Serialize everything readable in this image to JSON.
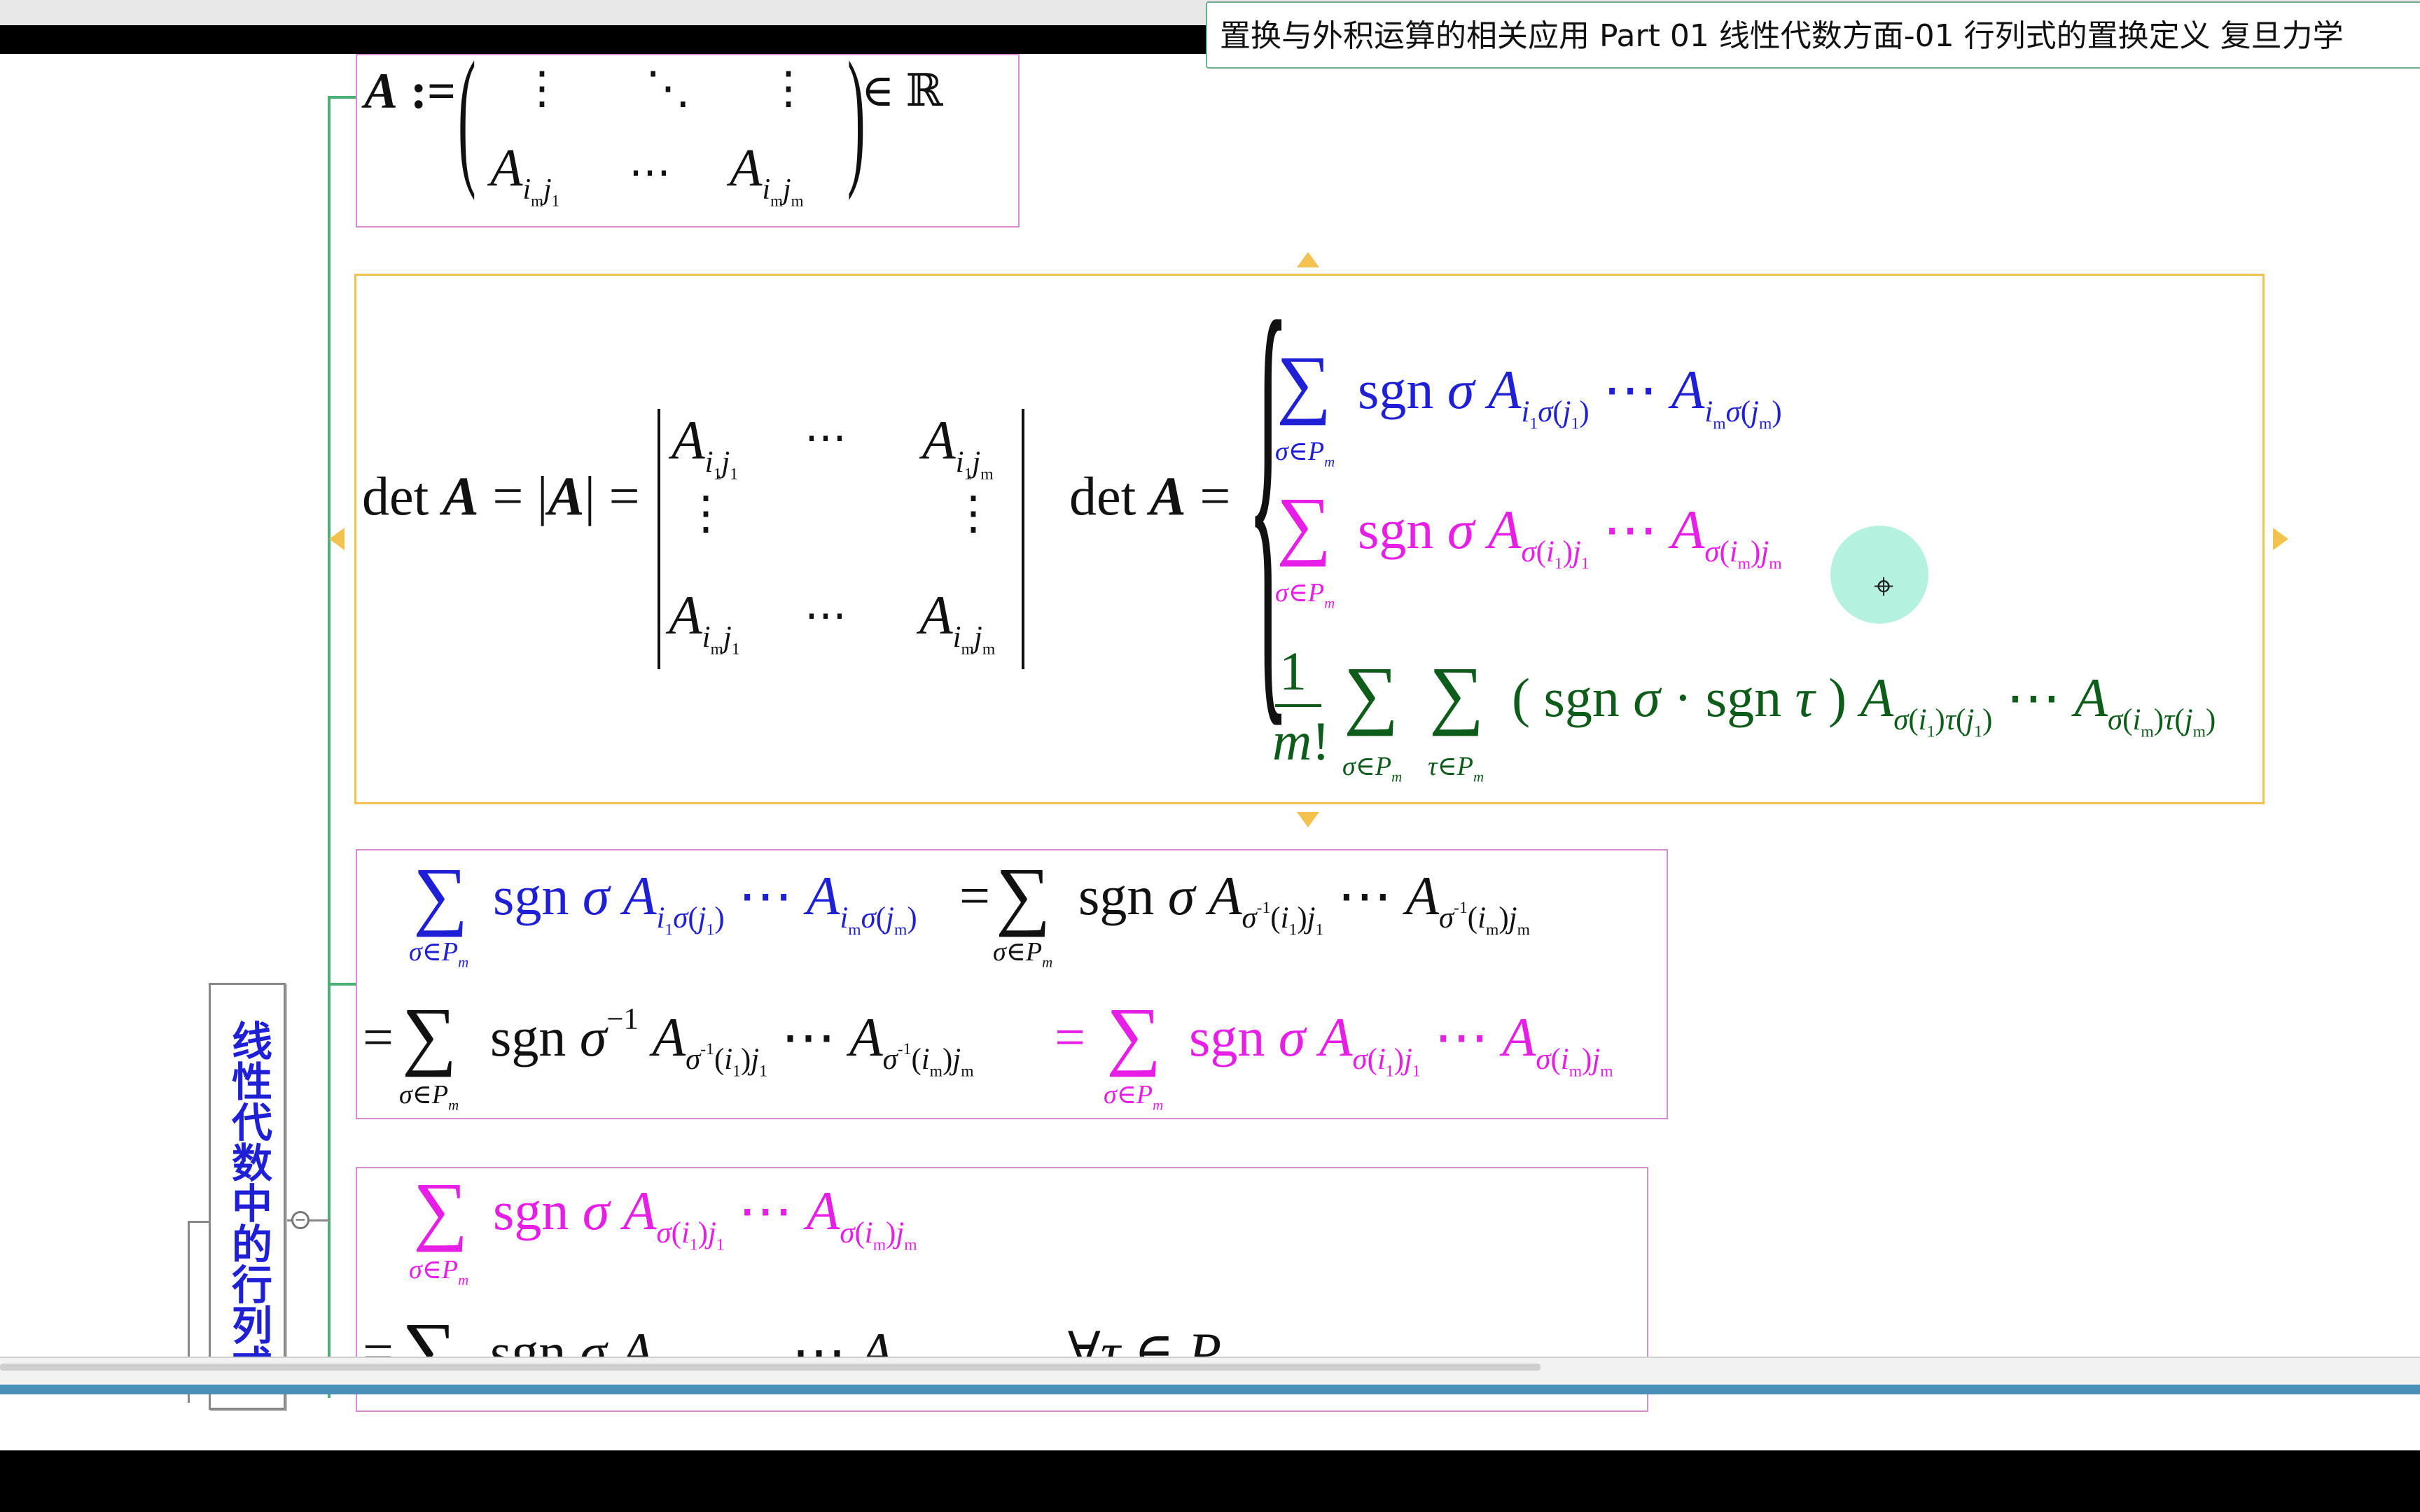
{
  "video_title": "置换与外积运算的相关应用 Part 01 线性代数方面-01 行列式的置换定义 复旦力学",
  "side_topic": "线性代数中的行列式",
  "topic1": {
    "lhs": "A :=",
    "rows": [
      "⋮ ⋱ ⋮",
      "A … A"
    ],
    "in_R": "∈ ℝ"
  },
  "topic2": {
    "left": "det A = |A| =",
    "matrix_cells": [
      "A",
      "⋯",
      "A",
      "⋮",
      "⋮",
      "A",
      "⋯",
      "A"
    ],
    "right_lhs": "det A ="
  },
  "colors": {
    "blue": "#1f1fd6",
    "magenta": "#e61ee6",
    "green": "#0d5c1a",
    "border": "#d98ad3",
    "selected": "#f2c14e"
  }
}
